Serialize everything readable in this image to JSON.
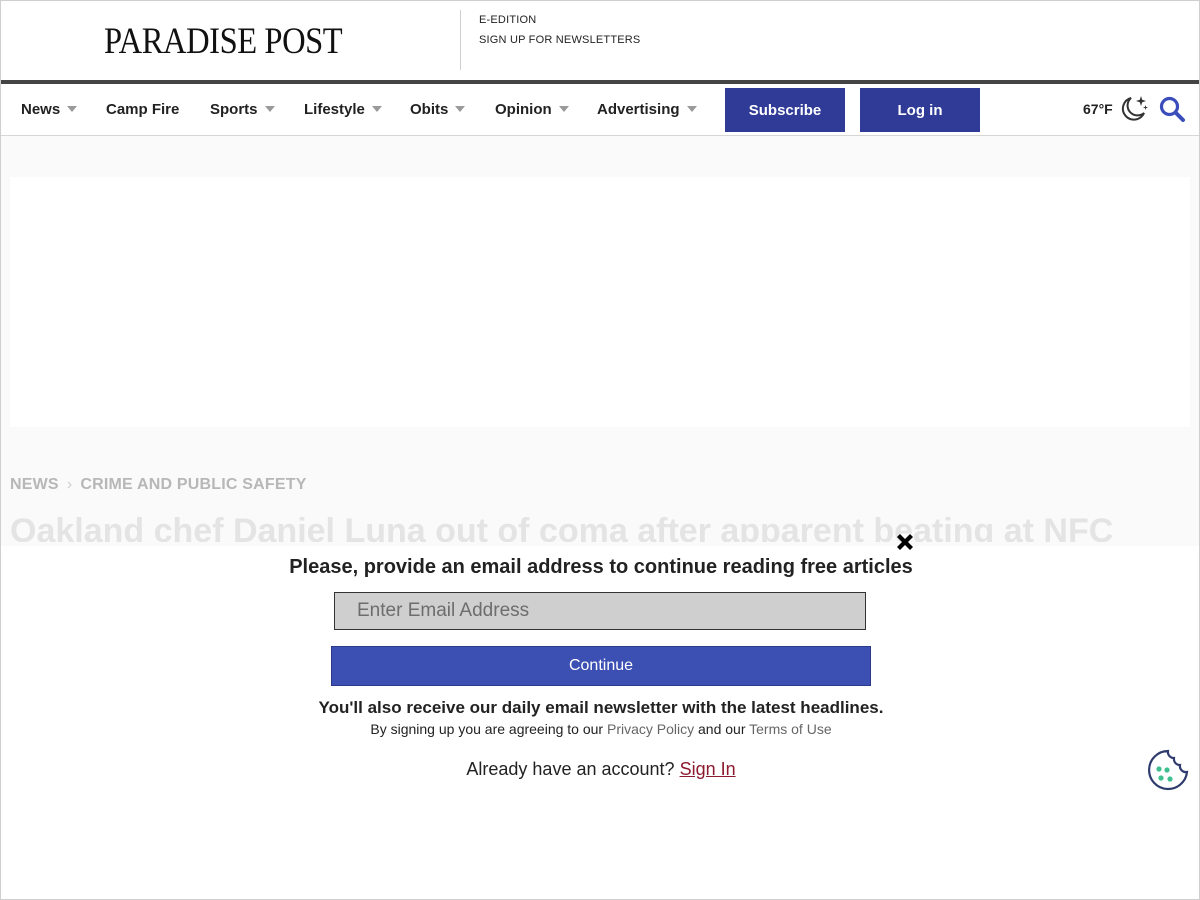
{
  "masthead": {
    "logo": "PARADISE POST",
    "links": [
      "E-EDITION",
      "SIGN UP FOR NEWSLETTERS"
    ]
  },
  "nav": {
    "items": [
      {
        "label": "News",
        "has_dropdown": true
      },
      {
        "label": "Camp Fire",
        "has_dropdown": false
      },
      {
        "label": "Sports",
        "has_dropdown": true
      },
      {
        "label": "Lifestyle",
        "has_dropdown": true
      },
      {
        "label": "Obits",
        "has_dropdown": true
      },
      {
        "label": "Opinion",
        "has_dropdown": true
      },
      {
        "label": "Advertising",
        "has_dropdown": true
      }
    ],
    "subscribe_label": "Subscribe",
    "login_label": "Log in",
    "temperature": "67°F",
    "weather_icon": "moon-stars-icon",
    "search_icon": "search-icon"
  },
  "article": {
    "breadcrumb": [
      "NEWS",
      "CRIME AND PUBLIC SAFETY"
    ],
    "headline_partial": "Oakland chef Daniel Luna out of coma after apparent beating at NFC"
  },
  "modal": {
    "title": "Please, provide an email address to continue reading free articles",
    "email_placeholder": "Enter Email Address",
    "continue_label": "Continue",
    "newsletter_note": "You'll also receive our daily email newsletter with the latest headlines.",
    "agree_prefix": "By signing up you are agreeing to our",
    "privacy_link": "Privacy Policy",
    "agree_middle": "and our",
    "terms_link": "Terms of Use",
    "account_prompt": "Already have an account?",
    "sign_in_link": "Sign In"
  },
  "colors": {
    "brand_blue": "#2f3b97",
    "continue_blue": "#3c4fb3",
    "sign_in_link": "#8b1a2e"
  }
}
